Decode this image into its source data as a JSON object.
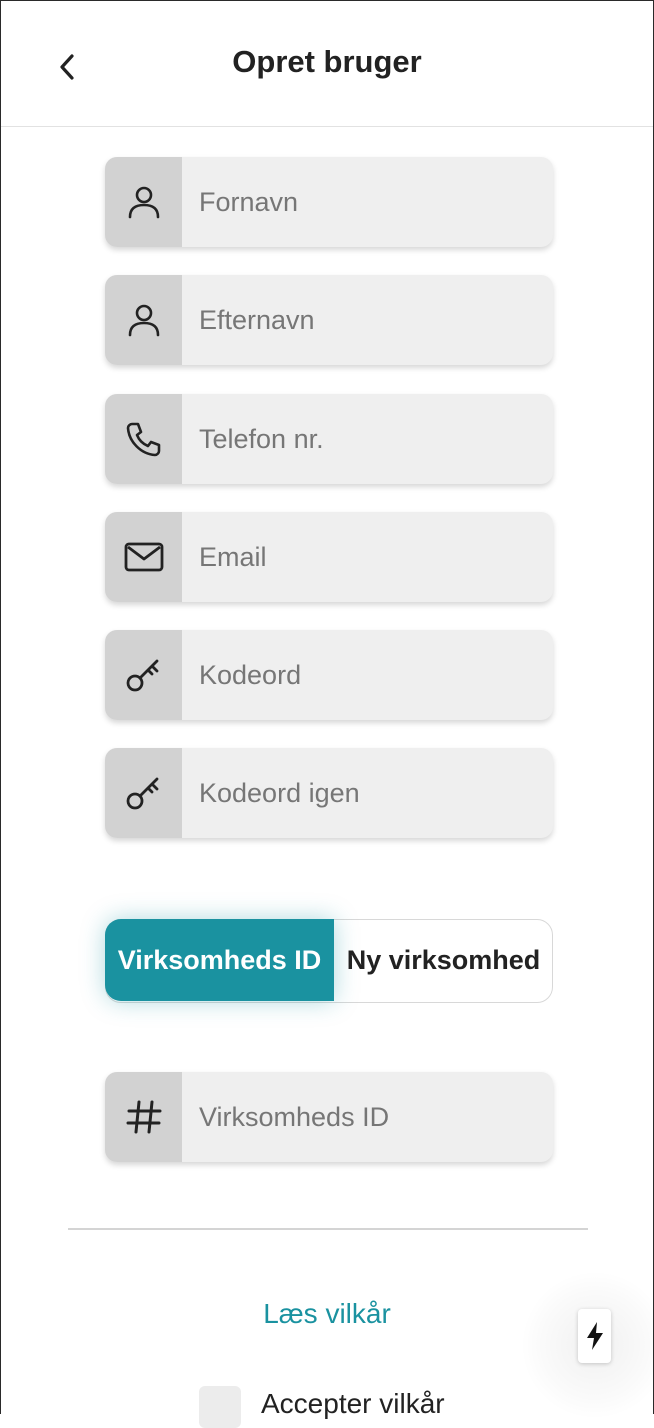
{
  "header": {
    "title": "Opret bruger",
    "back_icon": "chevron-left-icon"
  },
  "form": {
    "fields": [
      {
        "icon": "user-icon",
        "placeholder": "Fornavn",
        "value": ""
      },
      {
        "icon": "user-icon",
        "placeholder": "Efternavn",
        "value": ""
      },
      {
        "icon": "phone-icon",
        "placeholder": "Telefon nr.",
        "value": ""
      },
      {
        "icon": "mail-icon",
        "placeholder": "Email",
        "value": ""
      },
      {
        "icon": "key-icon",
        "placeholder": "Kodeord",
        "value": ""
      },
      {
        "icon": "key-icon",
        "placeholder": "Kodeord igen",
        "value": ""
      }
    ],
    "toggle": {
      "selected": "Virksomheds ID",
      "option_a": "Virksomheds ID",
      "option_b": "Ny virksomhed"
    },
    "company_field": {
      "icon": "hash-icon",
      "placeholder": "Virksomheds ID",
      "value": ""
    }
  },
  "terms": {
    "link": "Læs vilkår",
    "accept_label": "Accepter vilkår",
    "accepted": false
  },
  "fab": {
    "icon": "bolt-icon"
  },
  "colors": {
    "accent": "#1a92a0",
    "field_bg": "#efefef",
    "icon_bg": "#d2d2d2"
  }
}
